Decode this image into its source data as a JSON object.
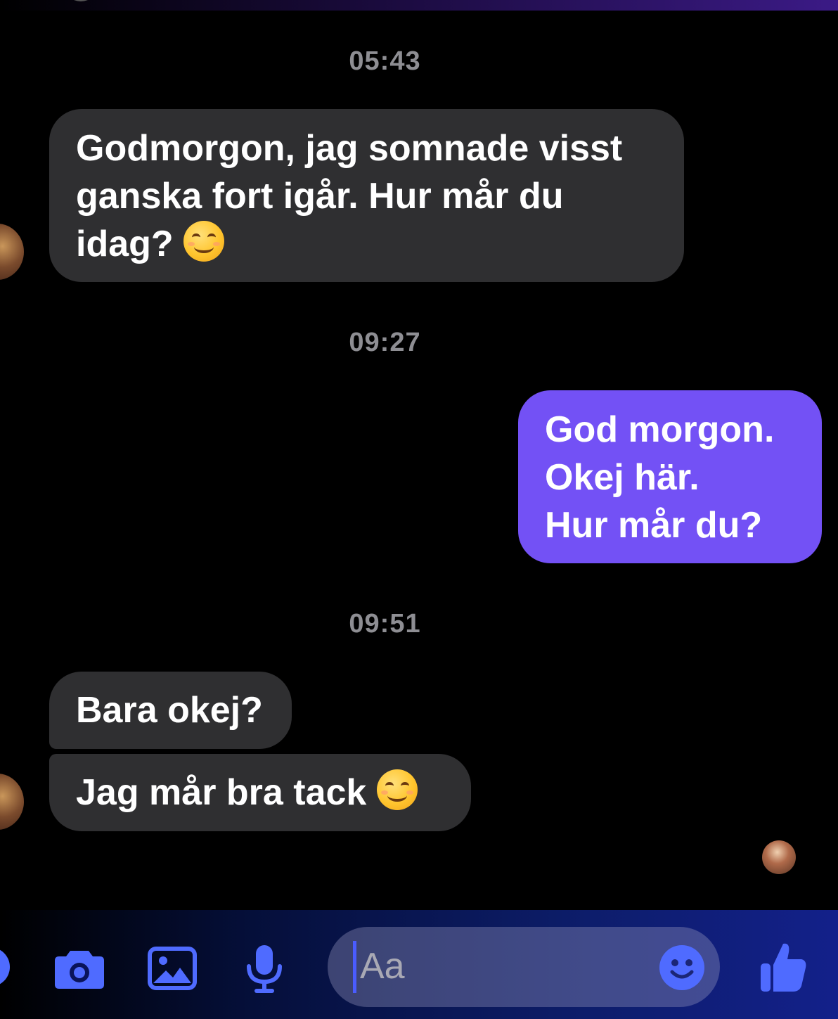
{
  "conversation": {
    "timestamps": [
      "05:43",
      "09:27",
      "09:51"
    ],
    "messages": [
      {
        "line1": "Godmorgon, jag somnade visst",
        "line2": "ganska fort igår. Hur mår du",
        "line3": "idag?",
        "emoji": "smiling-face-emoji"
      },
      {
        "line1": "God morgon.",
        "line2": "Okej här.",
        "line3": "Hur mår du?"
      },
      {
        "text": "Bara okej?"
      },
      {
        "text": "Jag mår bra tack",
        "emoji": "smiling-face-emoji"
      }
    ]
  },
  "composer": {
    "placeholder": "Aa",
    "icons": [
      "camera-icon",
      "gallery-icon",
      "microphone-icon",
      "emoji-icon",
      "thumbs-up-icon"
    ]
  },
  "colors": {
    "incoming_bubble": "#2f2f31",
    "outgoing_bubble": "#7351f5",
    "timestamp": "#8e8e93",
    "icon_accent": "#4f6bff"
  }
}
